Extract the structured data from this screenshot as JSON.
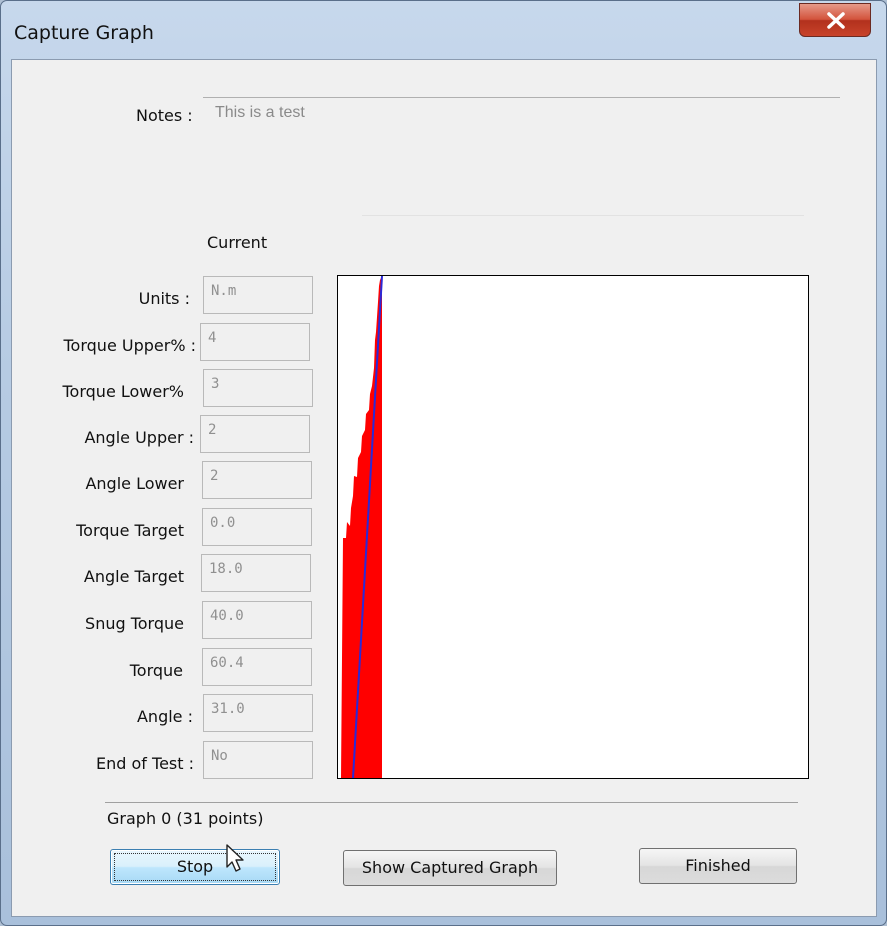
{
  "window": {
    "title": "Capture Graph"
  },
  "notes": {
    "label": "Notes :",
    "value": "This is a test"
  },
  "current_header": "Current",
  "fields": [
    {
      "label": "Units :",
      "value": "N.m"
    },
    {
      "label": "Torque Upper% :",
      "value": "4"
    },
    {
      "label": "Torque Lower%",
      "value": "3"
    },
    {
      "label": "Angle Upper :",
      "value": "2"
    },
    {
      "label": "Angle Lower",
      "value": "2"
    },
    {
      "label": "Torque Target",
      "value": "0.0"
    },
    {
      "label": "Angle Target",
      "value": "18.0"
    },
    {
      "label": "Snug Torque",
      "value": "40.0"
    },
    {
      "label": "Torque",
      "value": "60.4"
    },
    {
      "label": "Angle :",
      "value": "31.0"
    },
    {
      "label": "End of Test :",
      "value": "No"
    }
  ],
  "status": "Graph 0 (31 points)",
  "buttons": {
    "stop": "Stop",
    "show_captured": "Show Captured Graph",
    "finished": "Finished"
  },
  "colors": {
    "fill": "#ff0000",
    "line": "#2a2ad8"
  }
}
